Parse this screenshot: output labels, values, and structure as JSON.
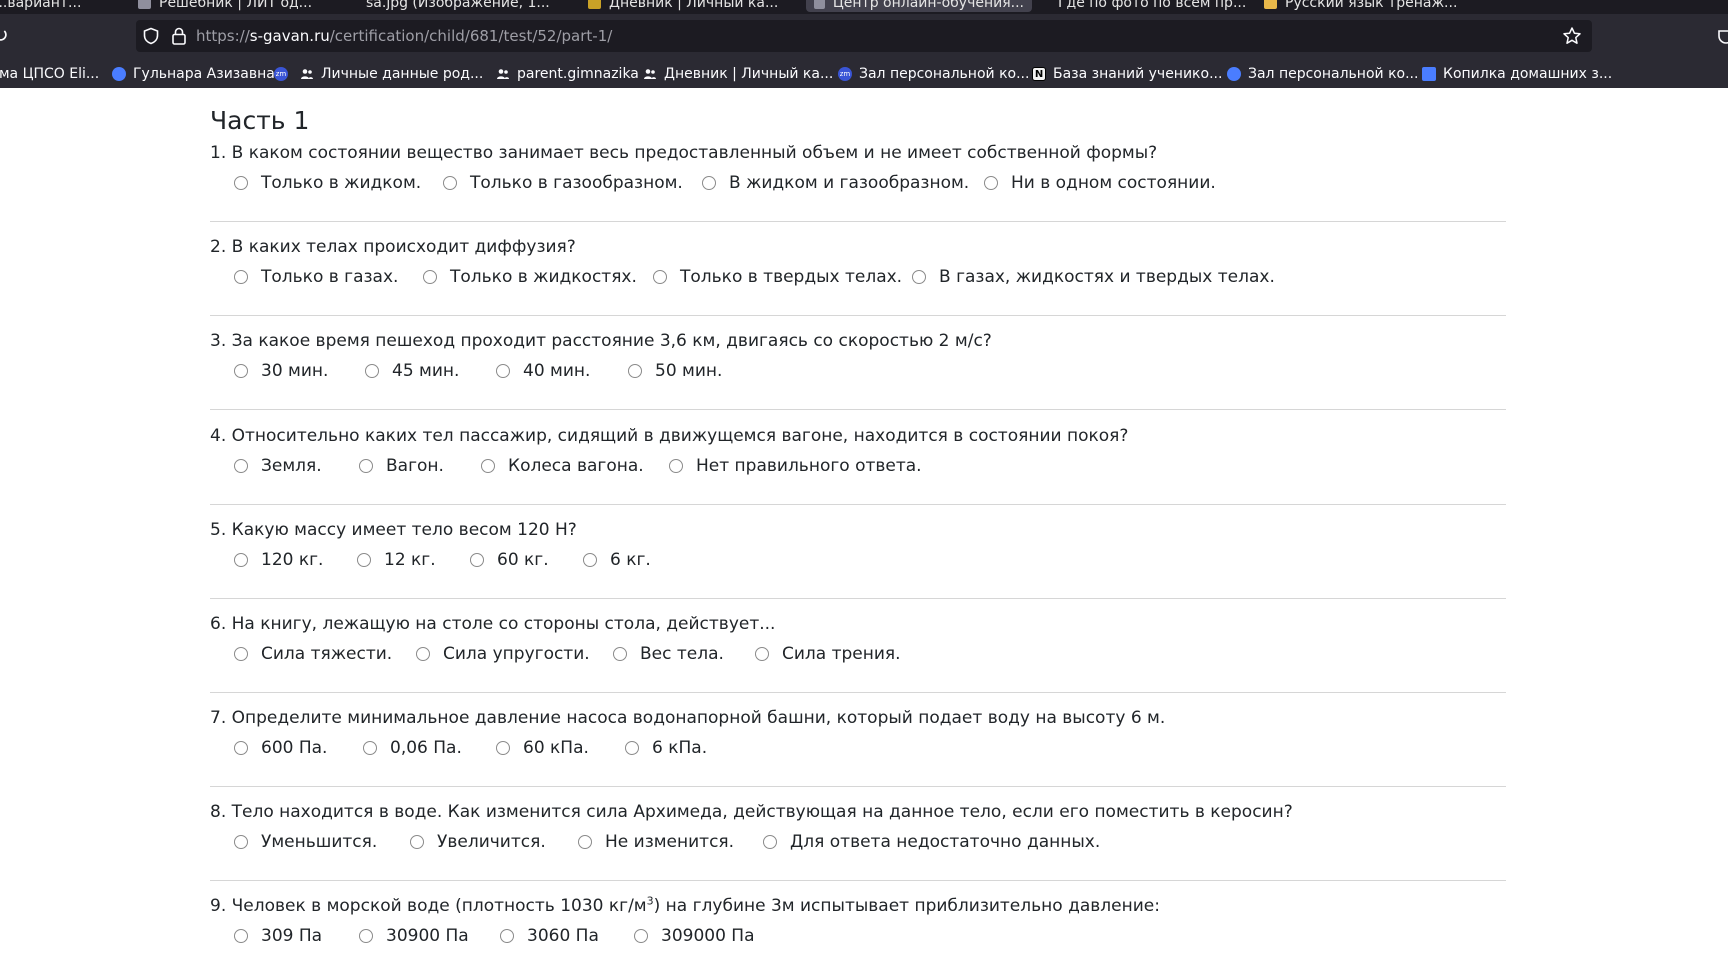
{
  "browser": {
    "tabs": [
      {
        "label": "...вариант..."
      },
      {
        "label": "Решебник | ЛИТ од..."
      },
      {
        "label": "sa.jpg (Изображение, 1..."
      },
      {
        "label": "Дневник | Личный ка..."
      },
      {
        "label": "Центр онлайн-обучения..."
      },
      {
        "label": "Где по фото по всем пр..."
      },
      {
        "label": "Русский язык тренаж..."
      }
    ],
    "url_prefix": "https://",
    "url_domain": "s-gavan.ru",
    "url_path": "/certification/child/681/test/52/part-1/",
    "bookmarks": [
      {
        "label": "ма ЦПСО Eli...",
        "icon": "none"
      },
      {
        "label": "Гульнара Азизавна",
        "icon": "zoom-icon"
      },
      {
        "label": "",
        "icon": "zm-icon"
      },
      {
        "label": "Личные данные род...",
        "icon": "people-icon"
      },
      {
        "label": "parent.gimnazika",
        "icon": "people-icon"
      },
      {
        "label": "Дневник | Личный ка...",
        "icon": "people-icon"
      },
      {
        "label": "Зал персональной ко...",
        "icon": "zm-icon"
      },
      {
        "label": "База знаний ученико...",
        "icon": "notion-icon"
      },
      {
        "label": "Зал персональной ко...",
        "icon": "zoom-icon"
      },
      {
        "label": "Копилка домашних з...",
        "icon": "doc-icon"
      }
    ]
  },
  "page": {
    "title": "Часть 1",
    "questions": [
      {
        "text": "1. В каком состоянии вещество занимает весь предоставленный объем и не имеет собственной формы?",
        "options": [
          "Только в жидком.",
          "Только в газообразном.",
          "В жидком и газообразном.",
          "Ни в одном состоянии."
        ]
      },
      {
        "text": "2. В каких телах происходит диффузия?",
        "options": [
          "Только в газах.",
          "Только в жидкостях.",
          "Только в твердых телах.",
          "В газах, жидкостях и твердых телах."
        ]
      },
      {
        "text": "3. За какое время пешеход проходит расстояние 3,6 км, двигаясь со скоростью 2 м/с?",
        "options": [
          "30 мин.",
          "45 мин.",
          "40 мин.",
          "50 мин."
        ]
      },
      {
        "text": "4. Относительно каких тел пассажир, сидящий в движущемся вагоне, находится в состоянии покоя?",
        "options": [
          "Земля.",
          "Вагон.",
          "Колеса вагона.",
          "Нет правильного ответа."
        ]
      },
      {
        "text": "5. Какую массу имеет тело весом 120 Н?",
        "options": [
          "120 кг.",
          "12 кг.",
          "60 кг.",
          "6 кг."
        ]
      },
      {
        "text": "6. На книгу, лежащую на столе со стороны стола, действует...",
        "options": [
          "Сила тяжести.",
          "Сила упругости.",
          "Вес тела.",
          "Сила трения."
        ]
      },
      {
        "text": "7. Определите минимальное давление насоса водонапорной башни, который подает воду на высоту 6 м.",
        "options": [
          "600 Па.",
          "0,06 Па.",
          "60 кПа.",
          "6 кПа."
        ]
      },
      {
        "text": "8. Тело находится в воде. Как изменится сила Архимеда, действующая на данное тело, если его поместить в керосин?",
        "options": [
          "Уменьшится.",
          "Увеличится.",
          "Не изменится.",
          "Для ответа недостаточно данных."
        ]
      },
      {
        "text_before": "9. Человек в морской воде (плотность 1030 кг/м",
        "text_sup": "3",
        "text_after": ") на глубине 3м испытывает приблизительно давление:",
        "options": [
          "309 Па",
          "30900 Па",
          "3060 Па",
          "309000 Па"
        ]
      }
    ]
  }
}
